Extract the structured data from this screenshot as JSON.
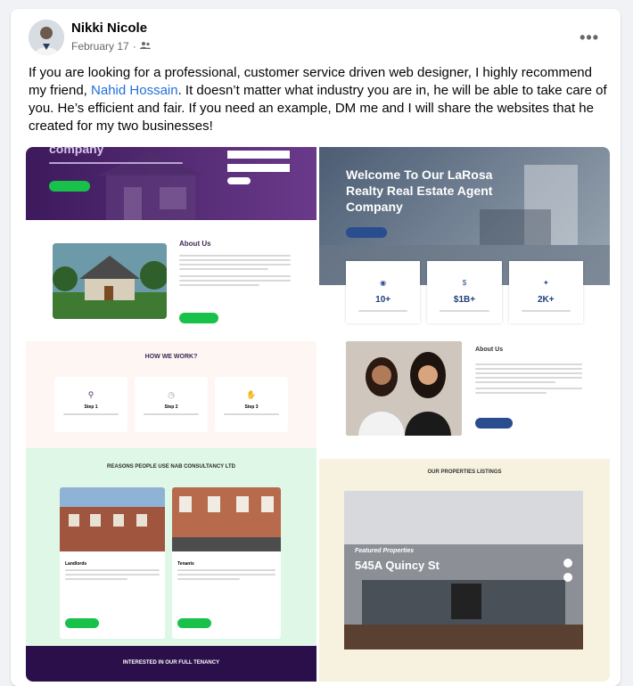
{
  "post": {
    "author": "Nikki Nicole",
    "date": "February 17",
    "audience_icon": "friends-icon",
    "text_before": "If you are looking for a professional, customer service driven web designer, I highly recommend my friend, ",
    "mention": "Nahid Hossain",
    "text_after": ". It doesn’t matter what industry you are in, he will be able to take care of you. He’s efficient and fair. If you need an example, DM me and I will share the websites that he created for my two businesses!",
    "more_label": "•••"
  },
  "left_site": {
    "hero_word": "company",
    "about_title": "About Us",
    "how_title": "HOW WE WORK?",
    "steps": [
      "Step 1",
      "Step 2",
      "Step 3"
    ],
    "reasons_title": "REASONS PEOPLE USE NAB CONSULTANCY LTD",
    "card_titles": [
      "Landlords",
      "Tenants"
    ],
    "bottom_title": "INTERESTED IN OUR FULL TENANCY"
  },
  "right_site": {
    "hero_title": "Welcome To Our LaRosa Realty Real Estate Agent Company",
    "stats": [
      "10+",
      "$1B+",
      "2K+"
    ],
    "about_title": "About Us",
    "listings_title": "OUR PROPERTIES LISTINGS",
    "featured_label": "Featured Properties",
    "address": "545A Quincy St"
  },
  "colors": {
    "link": "#216fdb",
    "accent_green": "#18c24a",
    "purple": "#4a1f6e",
    "navy": "#1e3f74"
  }
}
